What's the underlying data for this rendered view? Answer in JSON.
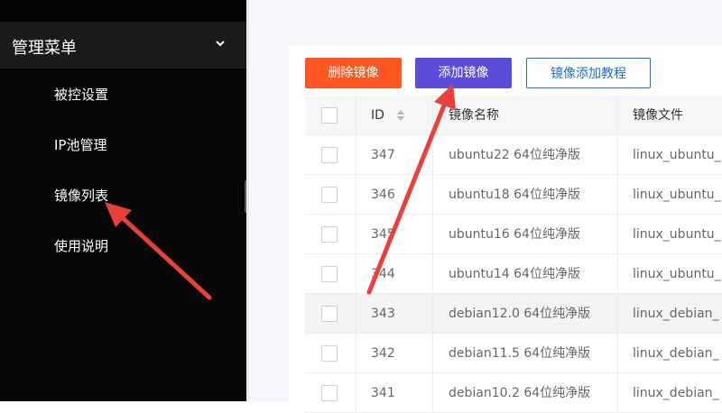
{
  "sidebar": {
    "header_title": "管理菜单",
    "items": [
      {
        "label": "被控设置"
      },
      {
        "label": "IP池管理"
      },
      {
        "label": "镜像列表"
      },
      {
        "label": "使用说明"
      }
    ]
  },
  "toolbar": {
    "delete_label": "删除镜像",
    "add_label": "添加镜像",
    "tutorial_label": "镜像添加教程"
  },
  "table": {
    "columns": {
      "id": "ID",
      "name": "镜像名称",
      "file": "镜像文件"
    },
    "rows": [
      {
        "id": "347",
        "name": "ubuntu22 64位纯净版",
        "file": "linux_ubuntu_"
      },
      {
        "id": "346",
        "name": "ubuntu18 64位纯净版",
        "file": "linux_ubuntu_"
      },
      {
        "id": "345",
        "name": "ubuntu16 64位纯净版",
        "file": "linux_ubuntu_"
      },
      {
        "id": "344",
        "name": "ubuntu14 64位纯净版",
        "file": "linux_ubuntu_"
      },
      {
        "id": "343",
        "name": "debian12.0 64位纯净版",
        "file": "linux_debian_"
      },
      {
        "id": "342",
        "name": "debian11.5 64位纯净版",
        "file": "linux_debian_"
      },
      {
        "id": "341",
        "name": "debian10.2 64位纯净版",
        "file": "linux_debian_"
      }
    ]
  },
  "colors": {
    "sidebar_bg": "#070707",
    "delete_button": "#ff5722",
    "add_button": "#5b4cdb",
    "tutorial_border": "#1e6bd6",
    "annotation_arrow": "#e8403a"
  },
  "icons": [
    "chevron-down-icon",
    "sort-icon",
    "annotation-arrow"
  ]
}
